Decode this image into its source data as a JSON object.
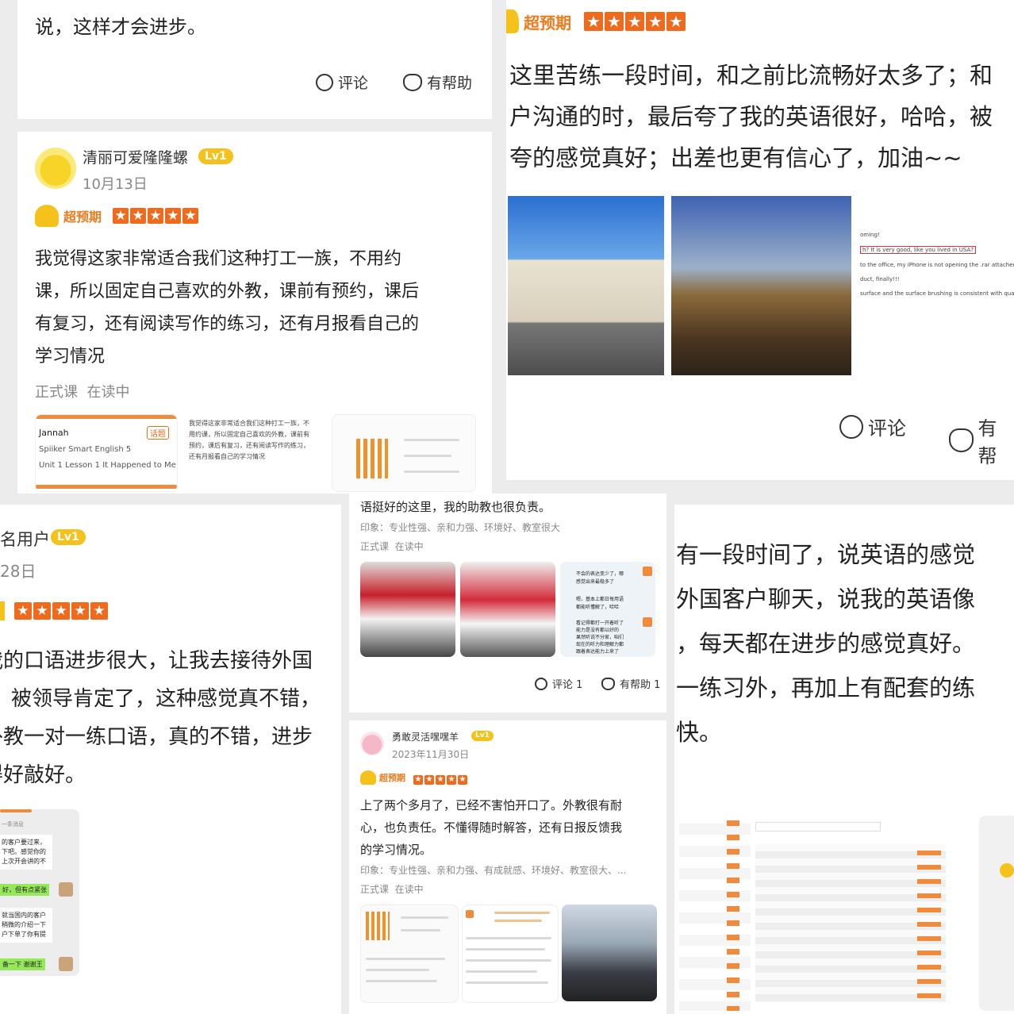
{
  "tl_card": {
    "text": "说，这样才会进步。",
    "comment": "评论",
    "helpful": "有帮助"
  },
  "ml_card": {
    "user": "清丽可爱隆隆螺",
    "level": "Lv1",
    "date": "10月13日",
    "tag": "超预期",
    "body": [
      "我觉得这家非常适合我们这种打工一族，不用约",
      "课，所以固定自己喜欢的外教，课前有预约，课后",
      "有复习，还有阅读写作的练习，还有月报看自己的",
      "学习情况"
    ],
    "meta": "正式课  在读中",
    "thumb1": {
      "name": "Jannah",
      "course": "Spiiker Smart English 5",
      "lesson": "Unit 1 Lesson 1 It Happened to Me!",
      "chip": "话题"
    },
    "thumb2": [
      "我觉得这家非常适合我们这种打工一族，不",
      "用约课，所以固定自己喜欢的外教，课前有",
      "预约，课后有复习，还有阅读写作的练习，",
      "还有月报看自己的学习情况"
    ]
  },
  "tr_card": {
    "tag": "超预期",
    "body": [
      "这里苦练一段时间，和之前比流畅好太多了；和",
      "户沟通的时，最后夸了我的英语很好，哈哈，被",
      "夸的感觉真好；出差也更有信心了，加油~~"
    ],
    "doc_lines": [
      "oming!",
      "h? It is very good, like you lived in USA?",
      "to the office, my iPhone is not opening the .rar attached.",
      "duct, finally!!!",
      "surface and the surface brushing is consistent with qual"
    ],
    "comment": "评论",
    "helpful": "有帮"
  },
  "bl_card": {
    "user": "名用户",
    "level": "Lv1",
    "date": "28日",
    "body": [
      "我的口语进步很大，让我去接待外国",
      "，被领导肯定了，这种感觉真不错，",
      "外教一对一练口语，真的不错，进步",
      "得好敲好。"
    ],
    "chat": [
      "一条消息",
      "的客户要过来，",
      "下吧。感觉你的",
      "上次开会讲的不",
      "好，但有点紧张",
      "就当国内的客户",
      "稍微的介绍一下",
      "户下单了你有提",
      "备一下 谢谢王"
    ]
  },
  "mid_card": {
    "top_text": "语挺好的这里，我的助教也很负责。",
    "impression": "印象：专业性强、亲和力强、环境好、教室很大",
    "meta": "正式课  在读中",
    "chat": [
      "不会的表达变少了，哪",
      "感觉出来最稳多了",
      "嗯，基本上都日每用语",
      "都能听懂解了，哈哈",
      "看记得都打一开着听了",
      "能力是没有都以好的",
      "果然听说不分家，咱们",
      "现在的听力和理解力都",
      "跟着表达能力上来了"
    ],
    "comment": "评论 1",
    "helpful": "有帮助 1"
  },
  "bm_card": {
    "user": "勇敢灵活嘿嘿羊",
    "level": "Lv1",
    "date": "2023年11月30日",
    "tag": "超预期",
    "body": [
      "上了两个多月了，已经不害怕开口了。外教很有耐",
      "心，也负责任。不懂得随时解答，还有日报反馈我",
      "的学习情况。"
    ],
    "impression": "印象：专业性强、亲和力强、有成就感、环境好、教室很大、...",
    "meta": "正式课  在读中"
  },
  "br_card": {
    "body": [
      "有一段时间了，说英语的感觉",
      "外国客户聊天，说我的英语像",
      "，每天都在进步的感觉真好。",
      "一练习外，再加上有配套的练",
      "快。"
    ]
  },
  "colors": {
    "orange": "#ef6a1d",
    "gold": "#f4c21b",
    "chat_green": "#94e85a"
  }
}
